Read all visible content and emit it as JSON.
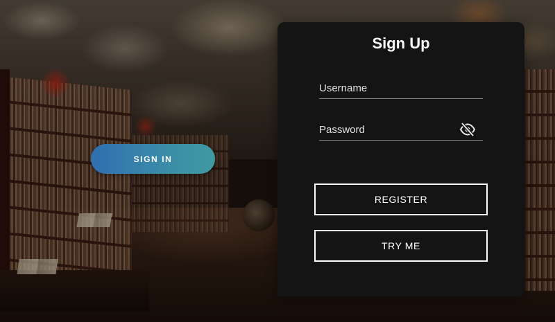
{
  "signin": {
    "label": "SIGN IN"
  },
  "signup": {
    "title": "Sign Up",
    "username_placeholder": "Username",
    "username_value": "",
    "password_placeholder": "Password",
    "password_value": "",
    "password_toggle_icon": "eye-off-icon",
    "register_label": "REGISTER",
    "tryme_label": "TRY ME"
  },
  "colors": {
    "panel_bg": "#141414",
    "signin_gradient_start": "#2f6fb0",
    "signin_gradient_end": "#3f9aa0",
    "button_border": "#ffffff",
    "text": "#ffffff"
  },
  "background": {
    "scene": "library-interior"
  }
}
